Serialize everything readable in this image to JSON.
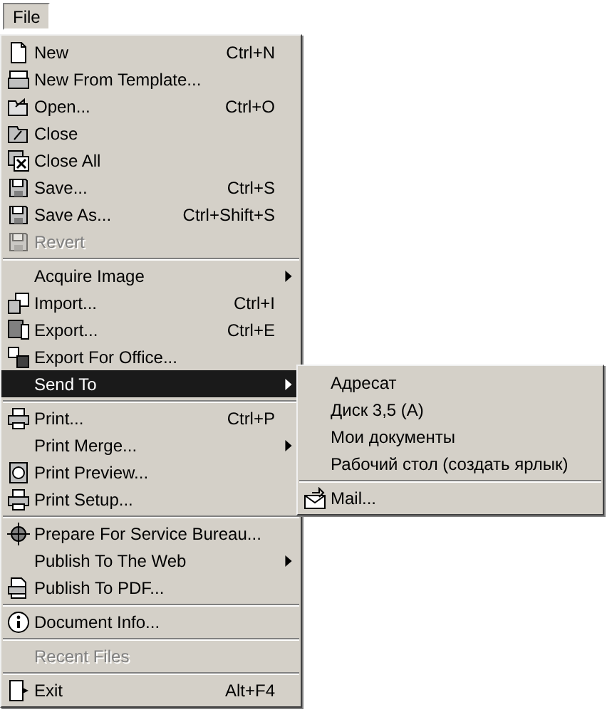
{
  "menu_bar": [
    {
      "label": "File",
      "selected": true
    }
  ],
  "menu": [
    {
      "kind": "item",
      "label": "New",
      "shortcut": "Ctrl+N",
      "submenu": false,
      "disabled": false,
      "selected": false
    },
    {
      "kind": "item",
      "label": "New From Template...",
      "submenu": false,
      "disabled": false,
      "selected": false
    },
    {
      "kind": "item",
      "label": "Open...",
      "shortcut": "Ctrl+O",
      "submenu": false,
      "disabled": false,
      "selected": false
    },
    {
      "kind": "item",
      "label": "Close",
      "submenu": false,
      "disabled": false,
      "selected": false
    },
    {
      "kind": "item",
      "label": "Close All",
      "submenu": false,
      "disabled": false,
      "selected": false
    },
    {
      "kind": "item",
      "label": "Save...",
      "shortcut": "Ctrl+S",
      "submenu": false,
      "disabled": false,
      "selected": false
    },
    {
      "kind": "item",
      "label": "Save As...",
      "shortcut": "Ctrl+Shift+S",
      "submenu": false,
      "disabled": false,
      "selected": false
    },
    {
      "kind": "item",
      "label": "Revert",
      "submenu": false,
      "disabled": true,
      "selected": false
    },
    {
      "kind": "separator"
    },
    {
      "kind": "item",
      "label": "Acquire Image",
      "submenu": true,
      "disabled": false,
      "selected": false
    },
    {
      "kind": "item",
      "label": "Import...",
      "shortcut": "Ctrl+I",
      "submenu": false,
      "disabled": false,
      "selected": false
    },
    {
      "kind": "item",
      "label": "Export...",
      "shortcut": "Ctrl+E",
      "submenu": false,
      "disabled": false,
      "selected": false
    },
    {
      "kind": "item",
      "label": "Export For Office...",
      "submenu": false,
      "disabled": false,
      "selected": false
    },
    {
      "kind": "item",
      "label": "Send To",
      "submenu": true,
      "disabled": false,
      "selected": true
    },
    {
      "kind": "separator"
    },
    {
      "kind": "item",
      "label": "Print...",
      "shortcut": "Ctrl+P",
      "submenu": false,
      "disabled": false,
      "selected": false
    },
    {
      "kind": "item",
      "label": "Print Merge...",
      "submenu": true,
      "disabled": false,
      "selected": false
    },
    {
      "kind": "item",
      "label": "Print Preview...",
      "submenu": false,
      "disabled": false,
      "selected": false
    },
    {
      "kind": "item",
      "label": "Print Setup...",
      "submenu": false,
      "disabled": false,
      "selected": false
    },
    {
      "kind": "separator"
    },
    {
      "kind": "item",
      "label": "Prepare For Service Bureau...",
      "submenu": false,
      "disabled": false,
      "selected": false
    },
    {
      "kind": "item",
      "label": "Publish To The Web",
      "submenu": true,
      "disabled": false,
      "selected": false
    },
    {
      "kind": "item",
      "label": "Publish To PDF...",
      "submenu": false,
      "disabled": false,
      "selected": false
    },
    {
      "kind": "separator"
    },
    {
      "kind": "item",
      "label": "Document Info...",
      "submenu": false,
      "disabled": false,
      "selected": false
    },
    {
      "kind": "separator"
    },
    {
      "kind": "item",
      "label": "Recent Files",
      "submenu": false,
      "disabled": true,
      "selected": false
    },
    {
      "kind": "separator"
    },
    {
      "kind": "item",
      "label": "Exit",
      "shortcut": "Alt+F4",
      "submenu": false,
      "disabled": false,
      "selected": false
    }
  ],
  "send_to_submenu": [
    {
      "kind": "item",
      "label": "Адресат",
      "selected": false
    },
    {
      "kind": "item",
      "label": "Диск 3,5 (A)",
      "selected": false
    },
    {
      "kind": "item",
      "label": "Мои документы",
      "selected": false
    },
    {
      "kind": "item",
      "label": "Рабочий стол (создать ярлык)",
      "selected": false
    },
    {
      "kind": "separator"
    },
    {
      "kind": "item",
      "label": "Mail...",
      "selected": false
    }
  ]
}
